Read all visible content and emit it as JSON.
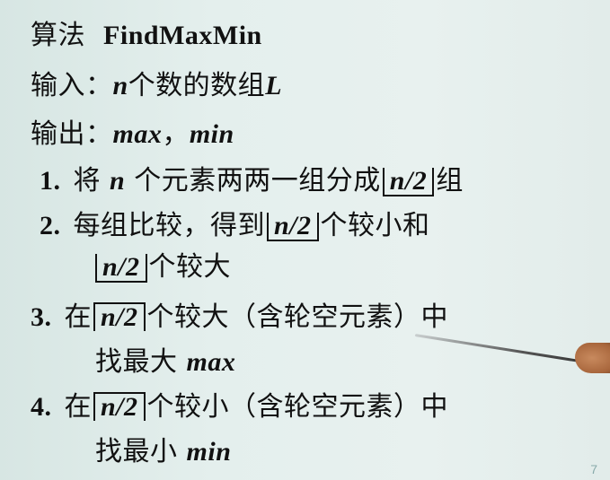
{
  "algorithm": {
    "title_prefix": "算法",
    "title_name": "FindMaxMin"
  },
  "input": {
    "label": "输入：",
    "var_n": "n",
    "text": "个数的数组",
    "var_l": "L"
  },
  "output": {
    "label": "输出：",
    "max": "max",
    "sep": "，",
    "min": "min"
  },
  "steps": [
    {
      "num": "1.",
      "a": "将",
      "var_n": "n",
      "b": "个元素两两一组分成",
      "bracket": "n/2",
      "c": "组"
    },
    {
      "num": "2.",
      "a": "每组比较，得到",
      "bracket": "n/2",
      "b": "个较小和",
      "bracket2": "n/2",
      "c": "个较大"
    },
    {
      "num": "3.",
      "a": "在",
      "bracket": "n/2",
      "b": "个较大（含轮空元素）中",
      "c": "找最大",
      "var": "max"
    },
    {
      "num": "4.",
      "a": "在",
      "bracket": "n/2",
      "b": "个较小（含轮空元素）中",
      "c": "找最小",
      "var": "min"
    }
  ],
  "page_number": "7"
}
